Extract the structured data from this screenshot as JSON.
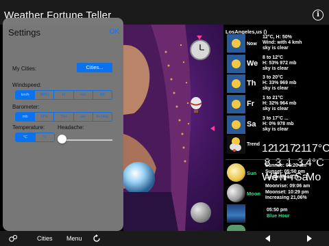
{
  "app": {
    "title": "Weather Fortune Teller",
    "info_icon": "info-icon"
  },
  "settings": {
    "title": "Settings",
    "ok_label": "OK",
    "my_cities_label": "My Cities:",
    "cities_button": "Cities...",
    "windspeed_label": "Windspeed:",
    "windspeed_options": [
      "km/h",
      "MPH",
      "kt",
      "m/s",
      "Bft"
    ],
    "windspeed_selected": 0,
    "barometer_label": "Barometer:",
    "barometer_options": [
      "mb",
      "hPa",
      "Torr",
      "psi",
      "inchHg"
    ],
    "barometer_selected": 0,
    "temperature_label": "Temperature:",
    "temperature_options": [
      "°C",
      "°F"
    ],
    "temperature_selected": 0,
    "headache_label": "Headache:",
    "headache_value": 0
  },
  "forecast": {
    "location": "LosAngeles,us ()",
    "days": [
      {
        "label": "Now",
        "lines": "12°C, H: 50%\nWind: with 4 kmh\nsky is clear",
        "icon": "sun-icon"
      },
      {
        "label": "We",
        "lines": "8 to 12°C\nH: 53% 972 mb\nsky is clear",
        "icon": "sun-icon"
      },
      {
        "label": "Th",
        "lines": "3 to 20°C\nH: 33% 969 mb\nsky is clear",
        "icon": "sun-icon"
      },
      {
        "label": "Fr",
        "lines": "1 to 21°C\nH: 32% 964 mb\nsky is clear",
        "icon": "sun-icon"
      },
      {
        "label": "Sa",
        "lines": "3 to 17°C ...\nH: 0% 978 mb\nsky is clear",
        "icon": "sun-icon"
      }
    ],
    "trend": {
      "label": "Trend",
      "columns": [
        {
          "top": "12",
          "mid": "8",
          "bot": "We"
        },
        {
          "top": "12",
          "mid": "3",
          "bot": "Th"
        },
        {
          "top": "17",
          "mid": "1",
          "bot": "Fr"
        },
        {
          "top": "21",
          "mid": "3",
          "bot": "Sa"
        },
        {
          "top": "17",
          "mid": "4°C",
          "bot": "Mo"
        }
      ],
      "right_unit": "17°C"
    }
  },
  "astro": [
    {
      "label": "Sun",
      "text": "Sunrise: 06:20 am\nSunset: 05:50 pm\nDaytime: 11:31",
      "icon": "sun-disc-icon"
    },
    {
      "label": "Moon",
      "text": "Moonrise: 09:06 am\nMoonset: 10:29 pm\nIncreasing 21,06%",
      "icon": "moon-icon"
    },
    {
      "label": "",
      "text": "05:50 pm",
      "sub": "Blue Hour",
      "icon": "blue-hour-icon"
    }
  ],
  "toolbar": {
    "settings_icon": "settings-icon",
    "cities_label": "Cities",
    "menu_label": "Menu",
    "refresh_icon": "refresh-icon",
    "back_icon": "back-icon",
    "forward_icon": "forward-icon"
  }
}
